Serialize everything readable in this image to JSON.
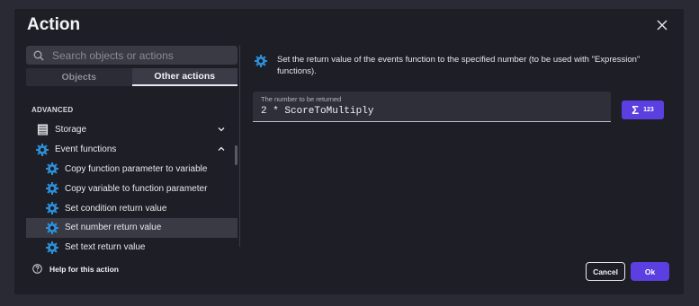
{
  "dialog": {
    "title": "Action"
  },
  "search": {
    "placeholder": "Search objects or actions"
  },
  "tabs": [
    {
      "label": "Objects",
      "active": false
    },
    {
      "label": "Other actions",
      "active": true
    }
  ],
  "section": {
    "label": "ADVANCED"
  },
  "list": {
    "storage": {
      "label": "Storage",
      "icon": "storage-icon",
      "expanded": false
    },
    "event_functions": {
      "label": "Event functions",
      "icon": "gear-icon",
      "expanded": true
    },
    "children": [
      {
        "label": "Copy function parameter to variable",
        "icon": "gear-icon"
      },
      {
        "label": "Copy variable to function parameter",
        "icon": "gear-icon"
      },
      {
        "label": "Set condition return value",
        "icon": "gear-icon"
      },
      {
        "label": "Set number return value",
        "icon": "gear-icon",
        "selected": true
      },
      {
        "label": "Set text return value",
        "icon": "gear-icon"
      }
    ]
  },
  "description": {
    "text": "Set the return value of the events function to the specified number (to be used with \"Expression\" functions)."
  },
  "field": {
    "label": "The number to be returned",
    "value": "2 * ScoreToMultiply"
  },
  "expression_button": {
    "symbol": "Σ",
    "label": "123"
  },
  "footer": {
    "help_label": "Help for this action",
    "cancel_label": "Cancel",
    "ok_label": "Ok"
  },
  "colors": {
    "accent": "#5b3fe0",
    "gear": "#2d8fd8",
    "background": "#1e1e26"
  }
}
